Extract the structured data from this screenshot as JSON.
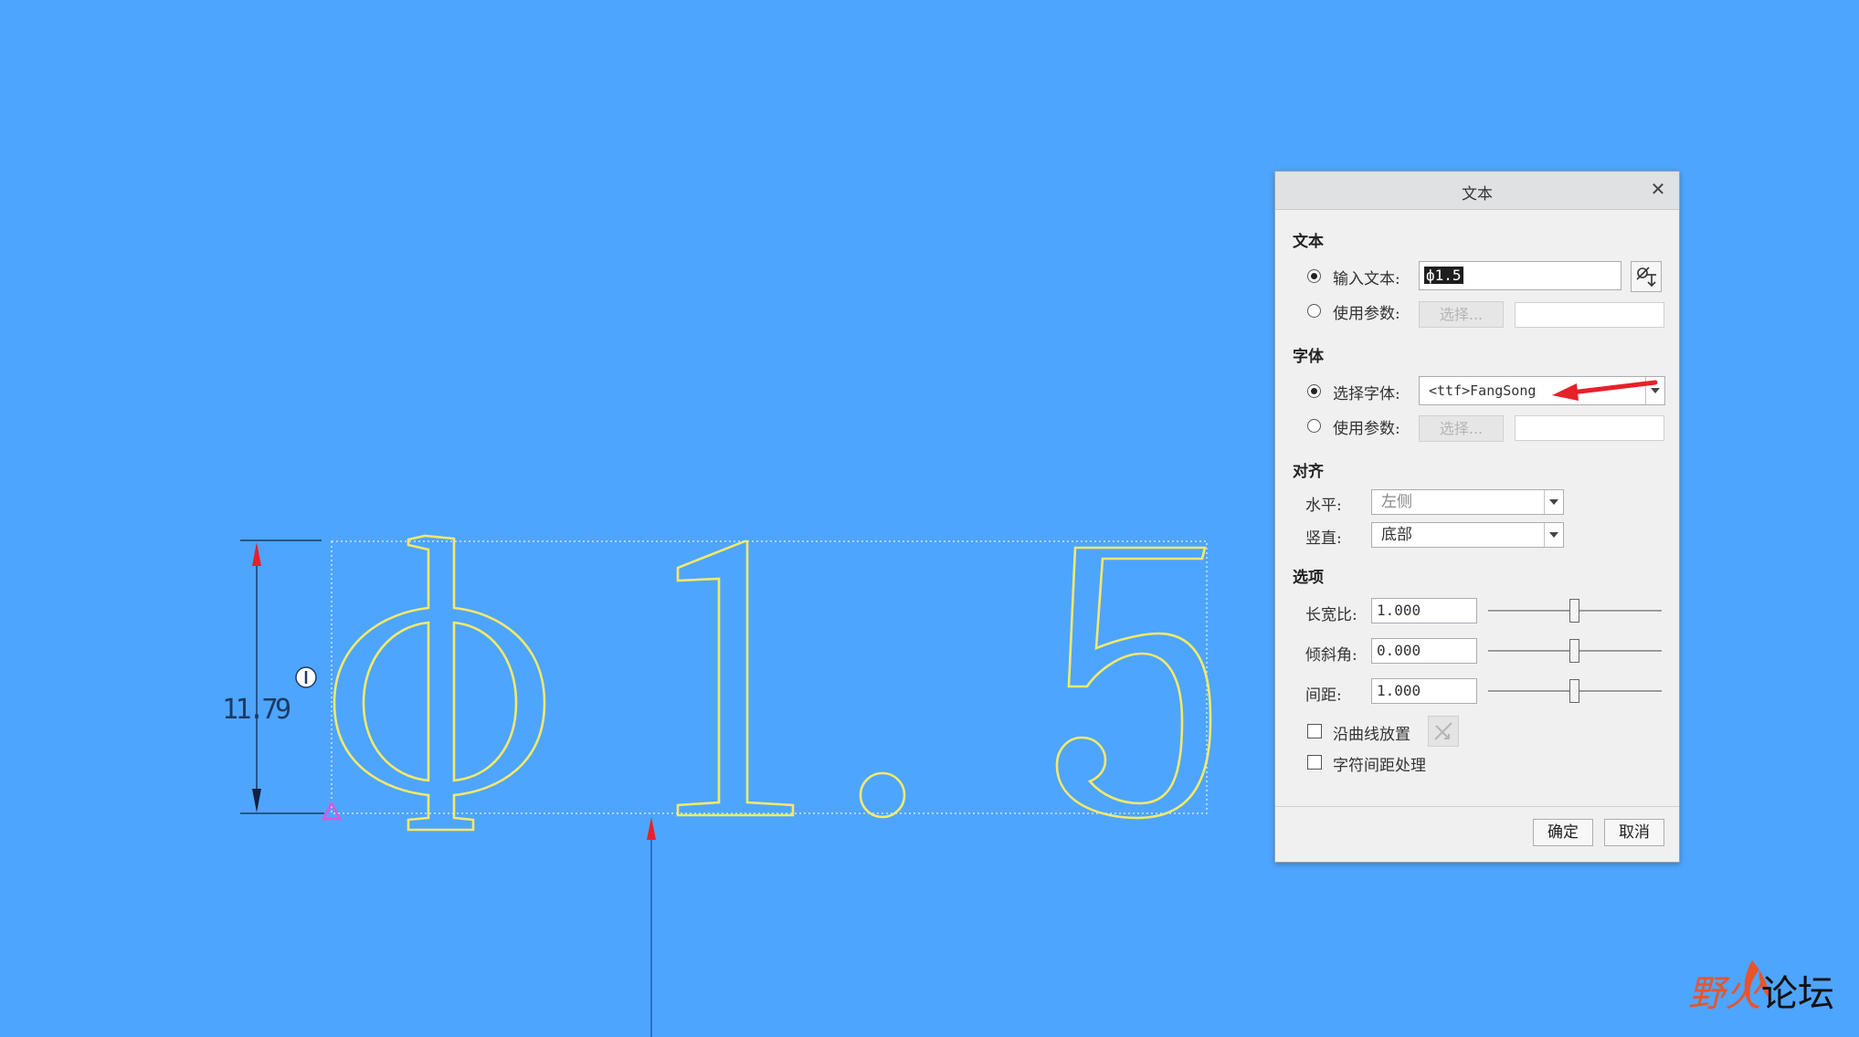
{
  "canvas": {
    "text_content": "Φ1.5",
    "dimension_value": "11.79",
    "outline_color": "#f5e96a"
  },
  "dialog": {
    "title": "文本",
    "sections": {
      "text": {
        "heading": "文本",
        "input_text_label": "输入文本:",
        "input_text_value": "ф1.5",
        "use_param_label": "使用参数:",
        "select_button": "选择..."
      },
      "font": {
        "heading": "字体",
        "select_font_label": "选择字体:",
        "font_value": "<ttf>FangSong",
        "use_param_label": "使用参数:",
        "select_button": "选择..."
      },
      "align": {
        "heading": "对齐",
        "horizontal_label": "水平:",
        "horizontal_value": "左侧",
        "vertical_label": "竖直:",
        "vertical_value": "底部"
      },
      "options": {
        "heading": "选项",
        "aspect_label": "长宽比:",
        "aspect_value": "1.000",
        "slant_label": "倾斜角:",
        "slant_value": "0.000",
        "spacing_label": "间距:",
        "spacing_value": "1.000",
        "along_curve_label": "沿曲线放置",
        "kerning_label": "字符间距处理"
      }
    },
    "ok_button": "确定",
    "cancel_button": "取消"
  },
  "watermark": {
    "part1": "野火",
    "part2": "论坛"
  },
  "colors": {
    "background": "#4ea5fe",
    "annotation_arrow": "#e8202a"
  }
}
